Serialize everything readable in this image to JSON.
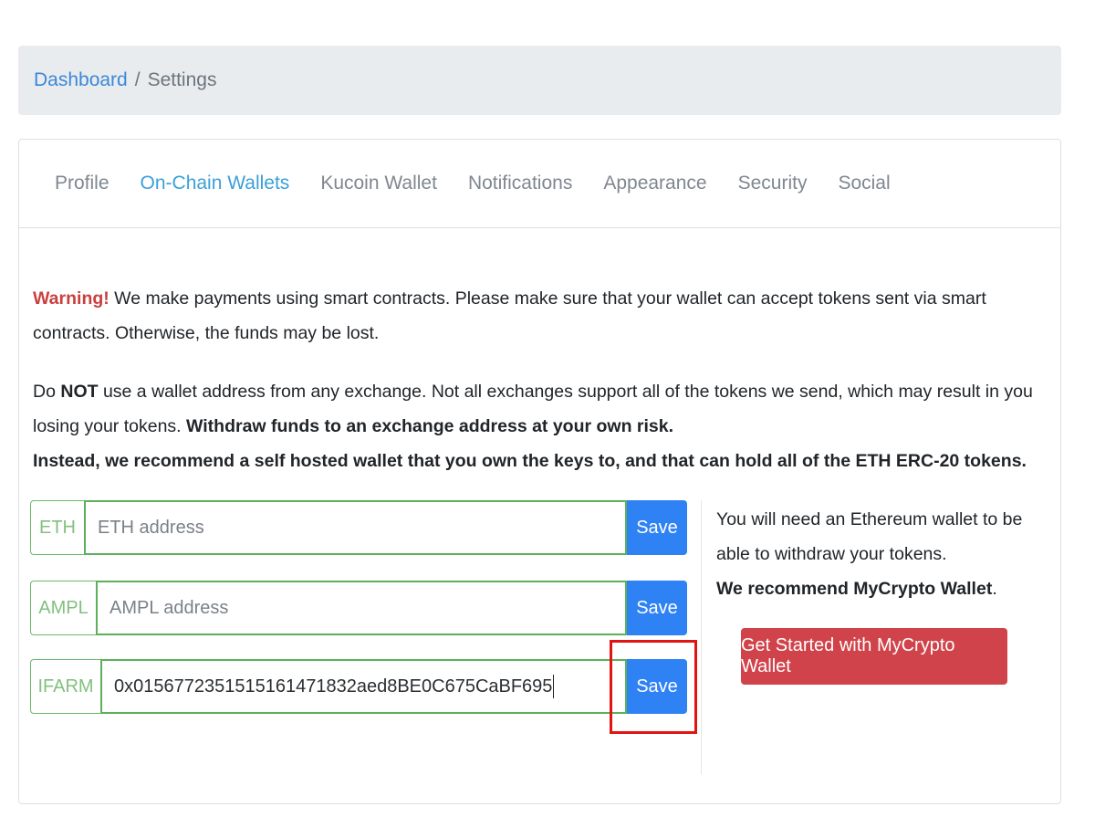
{
  "breadcrumb": {
    "home": "Dashboard",
    "separator": "/",
    "current": "Settings"
  },
  "tabs": [
    {
      "label": "Profile"
    },
    {
      "label": "On-Chain Wallets",
      "active": true
    },
    {
      "label": "Kucoin Wallet"
    },
    {
      "label": "Notifications"
    },
    {
      "label": "Appearance"
    },
    {
      "label": "Security"
    },
    {
      "label": "Social"
    }
  ],
  "warning": {
    "label": "Warning!",
    "text": " We make payments using smart contracts. Please make sure that your wallet can accept tokens sent via smart contracts. Otherwise, the funds may be lost.",
    "p2_a": "Do ",
    "p2_not": "NOT",
    "p2_b": " use a wallet address from any exchange. Not all exchanges support all of the tokens we send, which may result in you losing your tokens. ",
    "p2_bold": "Withdraw funds to an exchange address at your own risk.",
    "p2_recommend": "Instead, we recommend a self hosted wallet that you own the keys to, and that can hold all of the ETH ERC-20 tokens."
  },
  "wallets": [
    {
      "prefix": "ETH",
      "placeholder": "ETH address",
      "value": "",
      "save_label": "Save"
    },
    {
      "prefix": "AMPL",
      "placeholder": "AMPL address",
      "value": "",
      "save_label": "Save"
    },
    {
      "prefix": "IFARM",
      "placeholder": "",
      "value": "0x0156772351515161471832aed8BE0C675CaBF695",
      "save_label": "Save"
    }
  ],
  "side": {
    "text": "You will need an Ethereum wallet to be able to withdraw your tokens.",
    "recommend_bold": "We recommend MyCrypto Wallet",
    "recommend_end": ".",
    "cta_label": "Get Started with MyCrypto Wallet"
  },
  "colors": {
    "link": "#3b87d8",
    "active_tab": "#3aa0d8",
    "warning": "#c9403f",
    "input_border": "#5cb05a",
    "save_button": "#2f82f4",
    "cta_button": "#d0434a",
    "highlight": "#e01414"
  }
}
